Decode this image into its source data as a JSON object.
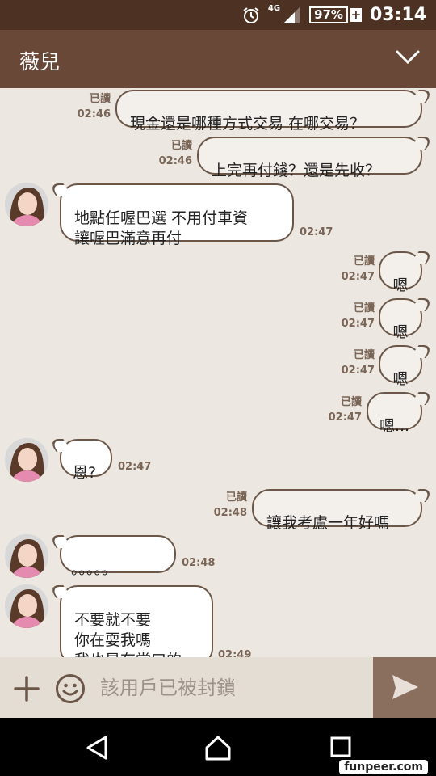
{
  "status_bar": {
    "network": "4G",
    "battery": "97%",
    "battery_plus": "+",
    "time": "03:14"
  },
  "header": {
    "title": "薇兒"
  },
  "messages": [
    {
      "side": "sent",
      "text": "現金還是哪種方式交易  在哪交易？",
      "read": "已讀",
      "time": "02:46"
    },
    {
      "side": "sent",
      "text": "上完再付錢？還是先收？",
      "read": "已讀",
      "time": "02:46"
    },
    {
      "side": "recv",
      "text": "地點任喔巴選  不用付車資\n讓喔巴滿意再付",
      "time": "02:47"
    },
    {
      "side": "sent",
      "text": "嗯",
      "read": "已讀",
      "time": "02:47"
    },
    {
      "side": "sent",
      "text": "嗯",
      "read": "已讀",
      "time": "02:47"
    },
    {
      "side": "sent",
      "text": "嗯",
      "read": "已讀",
      "time": "02:47"
    },
    {
      "side": "sent",
      "text": "嗯...",
      "read": "已讀",
      "time": "02:47"
    },
    {
      "side": "recv",
      "text": "恩?",
      "time": "02:47"
    },
    {
      "side": "sent",
      "text": "讓我考慮一年好嗎",
      "read": "已讀",
      "time": "02:48"
    },
    {
      "side": "recv",
      "text": "。。。。。",
      "time": "02:48"
    },
    {
      "side": "recv",
      "text": "不要就不要\n你在耍我嗎\n我也是有堂口的",
      "time": "02:49"
    }
  ],
  "input_bar": {
    "placeholder": "該用戶已被封鎖"
  },
  "watermark": "funpeer.com",
  "colors": {
    "status_bar": "#4d3224",
    "header": "#6a4837",
    "chat_bg": "#ece8e1",
    "bubble_border": "#6b5648"
  }
}
